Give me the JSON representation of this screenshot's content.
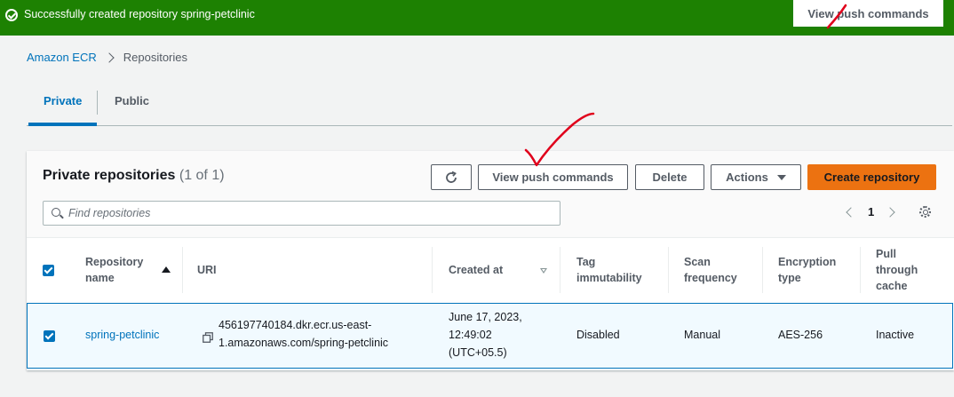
{
  "flash": {
    "message": "Successfully created repository spring-petclinic",
    "button_label": "View push commands"
  },
  "breadcrumb": {
    "root": "Amazon ECR",
    "current": "Repositories"
  },
  "tabs": {
    "private": "Private",
    "public": "Public"
  },
  "panel": {
    "title": "Private repositories",
    "count": "(1 of 1)",
    "buttons": {
      "view_push": "View push commands",
      "delete": "Delete",
      "actions": "Actions",
      "create": "Create repository"
    },
    "search_placeholder": "Find repositories",
    "page_number": "1"
  },
  "table": {
    "headers": {
      "name_line1": "Repository",
      "name_line2": "name",
      "uri": "URI",
      "created": "Created at",
      "tag_line1": "Tag",
      "tag_line2": "immutability",
      "scan_line1": "Scan",
      "scan_line2": "frequency",
      "enc_line1": "Encryption",
      "enc_line2": "type",
      "pull_line1": "Pull",
      "pull_line2": "through",
      "pull_line3": "cache"
    },
    "rows": [
      {
        "name": "spring-petclinic",
        "uri_line1": "456197740184.dkr.ecr.us-east-",
        "uri_line2": "1.amazonaws.com/spring-petclinic",
        "created_line1": "June 17, 2023,",
        "created_line2": "12:49:02",
        "created_line3": "(UTC+05.5)",
        "tag_immutability": "Disabled",
        "scan_frequency": "Manual",
        "encryption_type": "AES-256",
        "pull_through_cache": "Inactive"
      }
    ]
  },
  "colors": {
    "flash_green": "#1d8102",
    "link_blue": "#0073bb",
    "primary_orange": "#ec7211",
    "annotation_red": "#e0001b"
  }
}
